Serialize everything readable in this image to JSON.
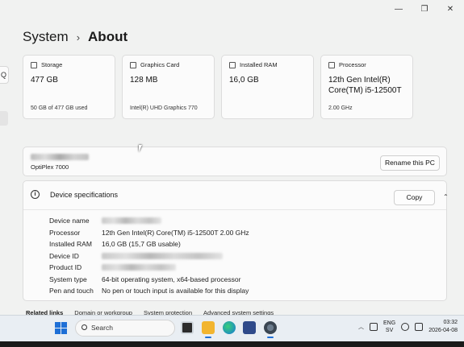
{
  "window": {
    "caption_minimize": "—",
    "caption_maximize": "❐",
    "caption_close": "✕"
  },
  "sidebar": {
    "search_glyph": "Q"
  },
  "breadcrumb": {
    "parent": "System",
    "separator": "›",
    "current": "About"
  },
  "cards": [
    {
      "icon": "storage-icon",
      "label": "Storage",
      "value": "477 GB",
      "sub": "50 GB of 477 GB used"
    },
    {
      "icon": "graphics-card-icon",
      "label": "Graphics Card",
      "value": "128 MB",
      "sub": "Intel(R) UHD Graphics 770"
    },
    {
      "icon": "ram-icon",
      "label": "Installed RAM",
      "value": "16,0 GB",
      "sub": ""
    },
    {
      "icon": "processor-icon",
      "label": "Processor",
      "value": "12th Gen Intel(R) Core(TM) i5-12500T",
      "sub": "2.00 GHz"
    }
  ],
  "device": {
    "model": "OptiPlex 7000",
    "rename_label": "Rename this PC"
  },
  "specs": {
    "title": "Device specifications",
    "copy_label": "Copy",
    "chevron": "⌃",
    "rows": [
      {
        "key": "Device name",
        "value": ""
      },
      {
        "key": "Processor",
        "value": "12th Gen Intel(R) Core(TM) i5-12500T   2.00 GHz"
      },
      {
        "key": "Installed RAM",
        "value": "16,0 GB (15,7 GB usable)"
      },
      {
        "key": "Device ID",
        "value": ""
      },
      {
        "key": "Product ID",
        "value": ""
      },
      {
        "key": "System type",
        "value": "64-bit operating system, x64-based processor"
      },
      {
        "key": "Pen and touch",
        "value": "No pen or touch input is available for this display"
      }
    ]
  },
  "related": {
    "label": "Related links",
    "links": [
      "Domain or workgroup",
      "System protection",
      "Advanced system settings"
    ]
  },
  "taskbar": {
    "search_placeholder": "Search",
    "lang_top": "ENG",
    "lang_bottom": "SV",
    "time": "03:32",
    "date": "2026-04-08"
  }
}
